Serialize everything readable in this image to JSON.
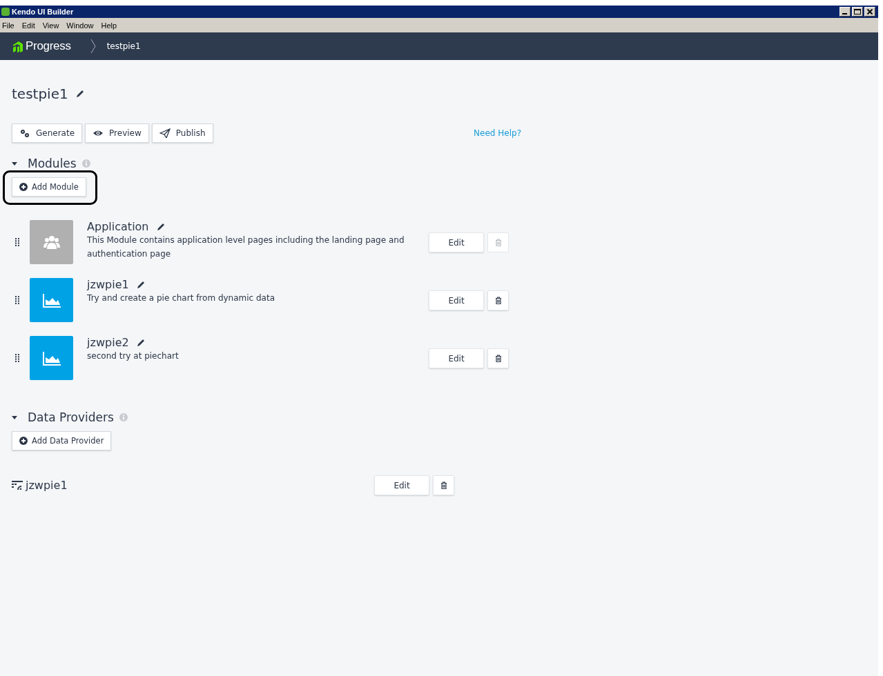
{
  "window": {
    "title": "Kendo UI Builder"
  },
  "menu": [
    "File",
    "Edit",
    "View",
    "Window",
    "Help"
  ],
  "header": {
    "logo": "Progress",
    "breadcrumb": "testpie1"
  },
  "app": {
    "name": "testpie1",
    "actions": [
      {
        "kind": "generate",
        "label": "Generate"
      },
      {
        "kind": "preview",
        "label": "Preview"
      },
      {
        "kind": "publish",
        "label": "Publish"
      }
    ],
    "help_link": "Need Help?"
  },
  "modules": {
    "title": "Modules",
    "expanded": true,
    "add_button": {
      "label": "Add Module",
      "highlighted": true
    },
    "items": [
      {
        "kind": "users",
        "name": "Application",
        "description": "This Module contains application level pages including the landing page and authentication page",
        "edit": "Edit",
        "delete_disabled": true
      },
      {
        "kind": "chart",
        "name": "jzwpie1",
        "description": "Try and create a pie chart from dynamic data",
        "edit": "Edit",
        "delete_disabled": false
      },
      {
        "kind": "chart",
        "name": "jzwpie2",
        "description": "second try at piechart",
        "edit": "Edit",
        "delete_disabled": false
      }
    ]
  },
  "data_providers": {
    "title": "Data Providers",
    "expanded": true,
    "add_button": {
      "label": "Add Data Provider",
      "highlighted": false
    },
    "items": [
      {
        "name": "jzwpie1",
        "edit": "Edit",
        "delete_disabled": false
      }
    ]
  }
}
